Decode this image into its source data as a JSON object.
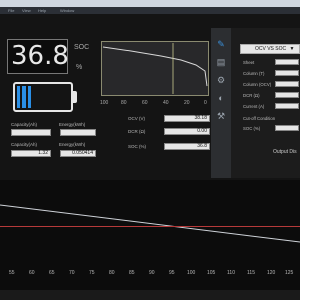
{
  "menubar": {
    "items": [
      "File",
      "View",
      "Help",
      "Window"
    ]
  },
  "soc": {
    "value": "36.8",
    "label": "SOC",
    "unit": "%"
  },
  "battery": {
    "level_fraction": 0.368,
    "accent": "#2a8fe6"
  },
  "capacity": {
    "row1": {
      "capacity_label": "Capacity(Ah)",
      "energy_label": "Energy(kWh)"
    },
    "row2": {
      "capacity_label": "Capacity(Ah)",
      "energy_label": "Energy(kWh)",
      "capacity_value": "1.32",
      "energy_value": "0.050414"
    }
  },
  "readouts": [
    {
      "label": "OCV (V)",
      "value": "38.18"
    },
    {
      "label": "DCR (Ω)",
      "value": "0.00"
    },
    {
      "label": "SOC (%)",
      "value": "36.8"
    }
  ],
  "ocv_plot": {
    "x_ticks": [
      "100",
      "80",
      "60",
      "40",
      "20",
      "0"
    ],
    "line_color": "#d8d8d8",
    "marker_color": "#c8c890"
  },
  "sidebar_icons": [
    "chart-icon",
    "table-icon",
    "settings-icon",
    "info-icon",
    "tools-icon"
  ],
  "param_panel": {
    "dropdown": "OCV VS SOC",
    "fields": [
      "Sheet",
      "Column (T)",
      "Column (OCV)",
      "DCR (Ω)",
      "Current (A)",
      "Cut-off Condition",
      "SOC (%)"
    ],
    "output_label": "Output Dis"
  },
  "trend_chart": {
    "x_ticks": [
      "55",
      "60",
      "65",
      "70",
      "75",
      "80",
      "85",
      "90",
      "95",
      "100",
      "105",
      "110",
      "115",
      "120",
      "125"
    ],
    "line_color": "#cfd3d9",
    "limit_color": "#b63a3a"
  }
}
